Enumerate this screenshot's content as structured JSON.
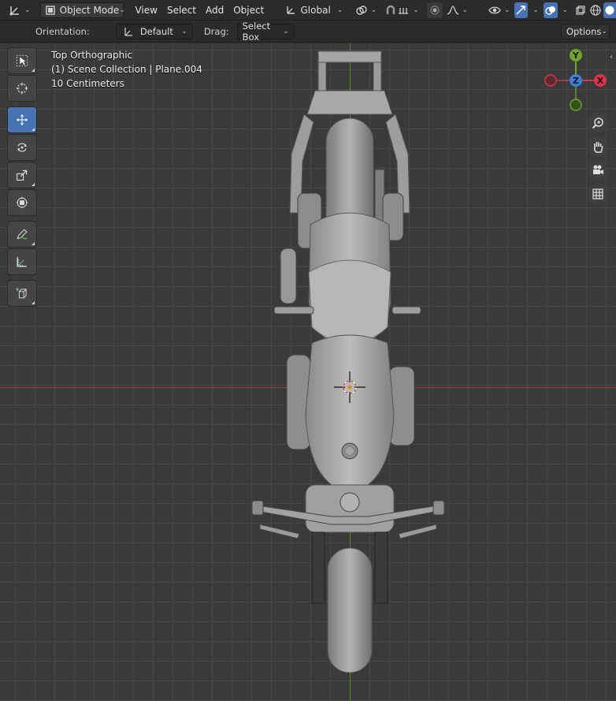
{
  "header": {
    "mode_label": "Object Mode",
    "menus": [
      "View",
      "Select",
      "Add",
      "Object"
    ],
    "transform_orientation": "Global"
  },
  "tool_settings": {
    "orientation_label": "Orientation:",
    "orientation_value": "Default",
    "drag_label": "Drag:",
    "drag_value": "Select Box",
    "options_label": "Options"
  },
  "viewport": {
    "view_name": "Top Orthographic",
    "collection_info": "(1) Scene Collection | Plane.004",
    "grid_scale": "10 Centimeters",
    "axis_x_color": "#a03a3a",
    "axis_y_color": "#5f8a2a"
  },
  "gizmo": {
    "y_label": "Y",
    "z_label": "Z",
    "x_label": "X",
    "x_color": "#d9334a",
    "y_color": "#6ea32c",
    "z_color": "#3b7fd6"
  },
  "tools": [
    {
      "name": "select-box-tool",
      "icon": "cursor-box-icon",
      "active": false
    },
    {
      "name": "cursor-tool",
      "icon": "3d-cursor-icon",
      "active": false
    },
    {
      "name": "move-tool",
      "icon": "move-arrows-icon",
      "active": true
    },
    {
      "name": "rotate-tool",
      "icon": "rotate-icon",
      "active": false
    },
    {
      "name": "scale-tool",
      "icon": "scale-icon",
      "active": false
    },
    {
      "name": "transform-tool",
      "icon": "transform-icon",
      "active": false
    },
    {
      "name": "annotate-tool",
      "icon": "pencil-icon",
      "active": false
    },
    {
      "name": "measure-tool",
      "icon": "ruler-icon",
      "active": false
    },
    {
      "name": "add-cube-tool",
      "icon": "add-cube-icon",
      "active": false
    }
  ],
  "nav_buttons": [
    "zoom-icon",
    "hand-pan-icon",
    "camera-icon",
    "grid-icon"
  ]
}
